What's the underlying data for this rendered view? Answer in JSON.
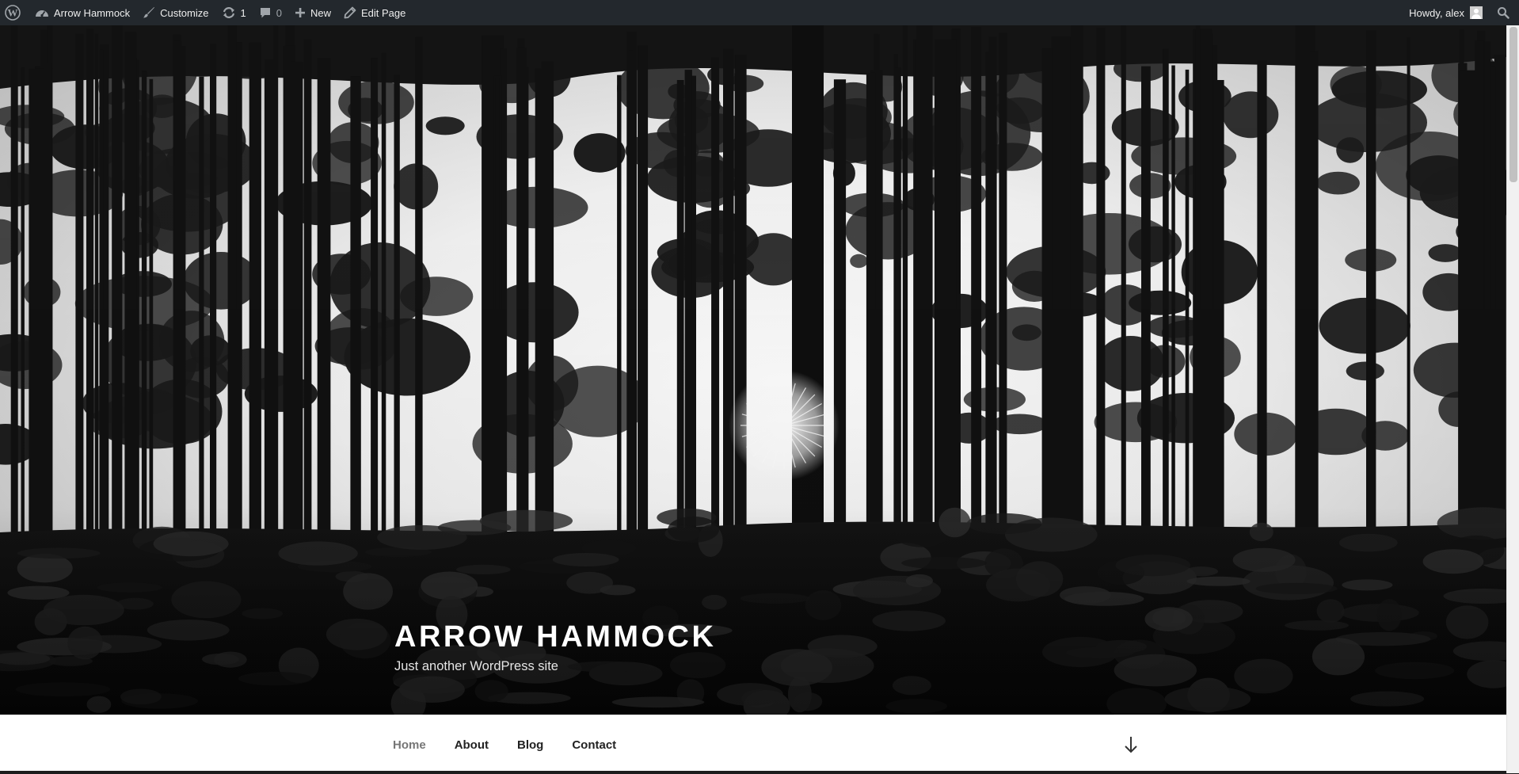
{
  "admin_bar": {
    "site_name": "Arrow Hammock",
    "customize": "Customize",
    "updates_count": "1",
    "comments_count": "0",
    "new_label": "New",
    "edit_page": "Edit Page",
    "howdy": "Howdy, alex"
  },
  "header": {
    "site_title": "ARROW HAMMOCK",
    "tagline": "Just another WordPress site"
  },
  "nav": {
    "items": [
      {
        "label": "Home",
        "current": true
      },
      {
        "label": "About"
      },
      {
        "label": "Blog"
      },
      {
        "label": "Contact"
      }
    ]
  },
  "icons": {
    "wp_logo": "wordpress-icon",
    "dashboard": "dashboard-icon",
    "customize": "paintbrush-icon",
    "updates": "refresh-icon",
    "comments": "comment-icon",
    "new": "plus-icon",
    "edit": "pencil-icon",
    "search": "search-icon",
    "avatar": "avatar-icon",
    "scroll_down": "arrow-down-icon"
  },
  "colors": {
    "admin_bar_bg": "#23282d",
    "admin_bar_text": "#eeeeee",
    "nav_current": "#767676",
    "nav_text": "#222222"
  }
}
